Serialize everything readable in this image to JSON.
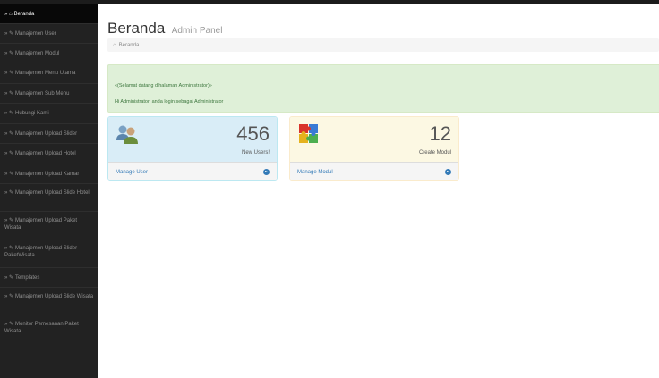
{
  "sidebar": {
    "items": [
      {
        "icon": "home-icon",
        "label": "Beranda",
        "active": true
      },
      {
        "icon": "wrench-icon",
        "label": "Manajemen User"
      },
      {
        "icon": "wrench-icon",
        "label": "Manajemen Modul"
      },
      {
        "icon": "wrench-icon",
        "label": "Manajemen Menu Utama"
      },
      {
        "icon": "wrench-icon",
        "label": "Manajemen Sub Menu"
      },
      {
        "icon": "wrench-icon",
        "label": "Hubungi Kami"
      },
      {
        "icon": "wrench-icon",
        "label": "Manajemen Upload Slider"
      },
      {
        "icon": "wrench-icon",
        "label": "Manajemen Upload Hotel"
      },
      {
        "icon": "wrench-icon",
        "label": "Manajemen Upload Kamar"
      },
      {
        "icon": "wrench-icon",
        "label": "Manajemen Upload Slide Hotel"
      },
      {
        "icon": "wrench-icon",
        "label": "Manajemen Upload Paket Wisata"
      },
      {
        "icon": "wrench-icon",
        "label": "Manajemen Upload Slider PaketWisata"
      },
      {
        "icon": "wrench-icon",
        "label": "Templates"
      },
      {
        "icon": "wrench-icon",
        "label": "Manajemen Upload Slide Wisata"
      },
      {
        "icon": "wrench-icon",
        "label": "Monitor Pemesanan Paket Wisata"
      }
    ]
  },
  "header": {
    "title": "Beranda",
    "subtitle": "Admin Panel"
  },
  "breadcrumb": {
    "icon": "home-icon",
    "label": "Beranda"
  },
  "alert": {
    "line1": "«(Selamat datang dihalaman Administrator)»",
    "line2": "Hi Administrator, anda login sebagai Administrator"
  },
  "panels": {
    "users": {
      "icon": "users-icon",
      "count": "456",
      "caption": "New Users!",
      "link": "Manage User",
      "accent": "#d9edf7"
    },
    "modul": {
      "icon": "puzzle-icon",
      "count": "12",
      "caption": "Create Modul",
      "link": "Manage Modul",
      "accent": "#fcf8e3"
    }
  },
  "colors": {
    "sidebar": "#222222",
    "link": "#337ab7",
    "alert_bg": "#dff0d8",
    "alert_text": "#3c763d"
  }
}
